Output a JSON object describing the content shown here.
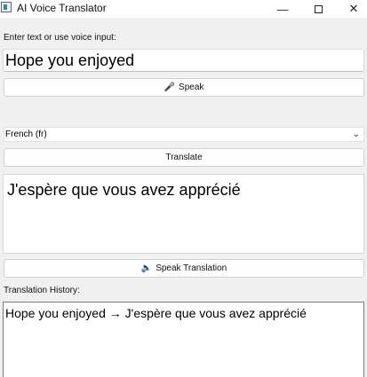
{
  "window": {
    "title": "AI Voice Translator",
    "controls": {
      "minimize": "—",
      "close": "✕"
    }
  },
  "input": {
    "label": "Enter text or use voice input:",
    "value": "Hope you enjoyed",
    "speak_button": {
      "icon": "microphone-icon",
      "glyph": "🎤",
      "label": "Speak"
    }
  },
  "language": {
    "selected": "French (fr)",
    "chevron": "⌄"
  },
  "translate_button": {
    "label": "Translate"
  },
  "output": {
    "text": "J'espère que vous avez apprécié"
  },
  "speak_translation_button": {
    "icon": "speaker-icon",
    "glyph": "🔈",
    "label": "Speak Translation"
  },
  "history": {
    "label": "Translation History:",
    "entries": [
      "Hope you enjoyed → J'espère que vous avez apprécié"
    ]
  }
}
